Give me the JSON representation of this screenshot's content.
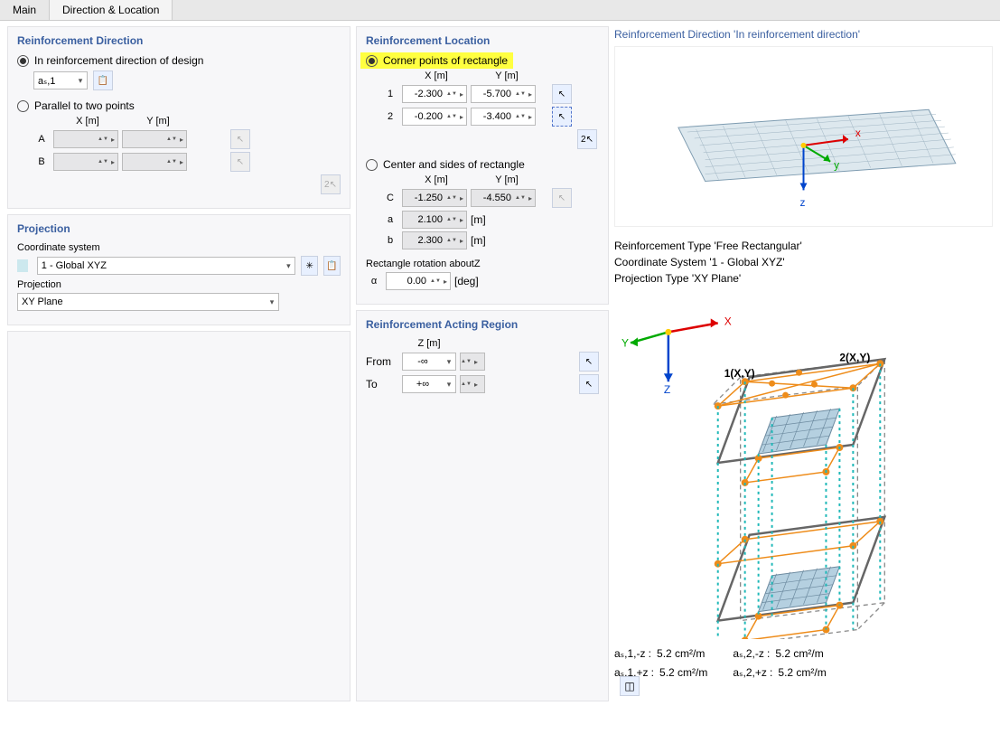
{
  "tabs": {
    "main": "Main",
    "dirloc": "Direction & Location"
  },
  "reinfdir": {
    "title": "Reinforcement Direction",
    "opt1": "In reinforcement direction of design",
    "as_sel": "aₛ,1",
    "opt2": "Parallel to two points",
    "xh": "X [m]",
    "yh": "Y [m]",
    "A": "A",
    "B": "B"
  },
  "proj": {
    "title": "Projection",
    "cs_lbl": "Coordinate system",
    "cs_val": "1 - Global XYZ",
    "proj_lbl": "Projection",
    "proj_val": "XY Plane"
  },
  "loc": {
    "title": "Reinforcement Location",
    "corner": "Corner points of rectangle",
    "center": "Center and sides of rectangle",
    "xh": "X [m]",
    "yh": "Y [m]",
    "m": "[m]",
    "r1x": "-2.300",
    "r1y": "-5.700",
    "r2x": "-0.200",
    "r2y": "-3.400",
    "cx": "-1.250",
    "cy": "-4.550",
    "a": "2.100",
    "b": "2.300",
    "rot_lbl": "Rectangle rotation aboutZ",
    "alpha": "α",
    "alpha_val": "0.00",
    "deg": "[deg]",
    "p1": "1",
    "p2": "2",
    "C": "C",
    "al": "a",
    "bl": "b"
  },
  "act": {
    "title": "Reinforcement Acting Region",
    "zh": "Z [m]",
    "from": "From",
    "to": "To",
    "minf": "-∞",
    "pinf": "+∞"
  },
  "right": {
    "t1": "Reinforcement Direction 'In reinforcement direction'",
    "info1": "Reinforcement Type 'Free Rectangular'",
    "info2": "Coordinate System '1 - Global XYZ'",
    "info3": "Projection Type 'XY Plane'",
    "label1": "1(X,Y)",
    "label2": "2(X,Y)",
    "X": "X",
    "Y": "Y",
    "Z": "Z",
    "x": "x",
    "y": "y",
    "z": "z",
    "as": {
      "a11": "aₛ,1,-z",
      "a12": "aₛ,1,+z",
      "a21": "aₛ,2,-z",
      "a22": "aₛ,2,+z",
      "v": "5.2 cm²/m",
      "colon": ":"
    }
  }
}
